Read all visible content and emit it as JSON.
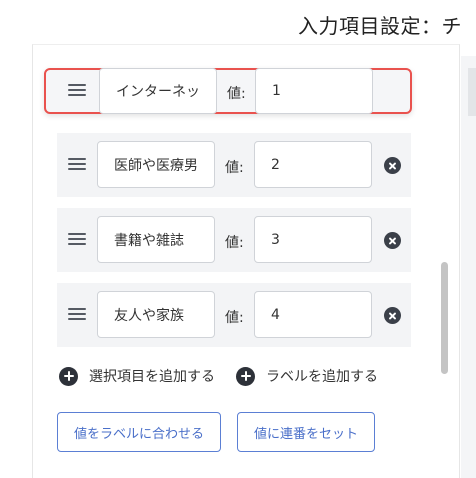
{
  "header": {
    "title": "入力項目設定：チ"
  },
  "items": [
    {
      "label": "インターネッ",
      "value_caption": "値:",
      "value": "1",
      "removable": false
    },
    {
      "label": "医師や医療男",
      "value_caption": "値:",
      "value": "2",
      "removable": true
    },
    {
      "label": "書籍や雑誌",
      "value_caption": "値:",
      "value": "3",
      "removable": true
    },
    {
      "label": "友人や家族",
      "value_caption": "値:",
      "value": "4",
      "removable": true
    }
  ],
  "actions": {
    "add_option_label": "選択項目を追加する",
    "add_label_label": "ラベルを追加する",
    "match_values_label": "値をラベルに合わせる",
    "set_sequence_label": "値に連番をセット"
  },
  "icons": {
    "drag": "drag-handle-icon",
    "remove": "remove-circle-icon",
    "add": "plus-circle-icon"
  },
  "colors": {
    "selection_border": "#e9524e",
    "button_accent": "#4a6fc9",
    "row_background": "#f3f4f6",
    "icon_dark": "#3b4049"
  }
}
